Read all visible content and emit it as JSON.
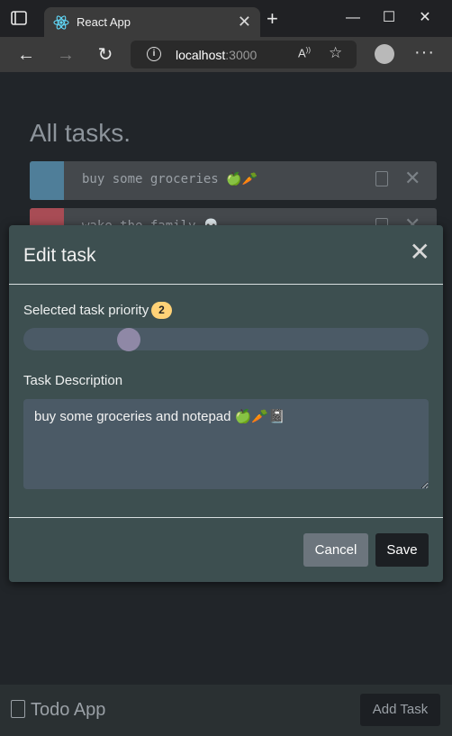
{
  "browser": {
    "tab_title": "React App",
    "close_tab": "✕",
    "new_tab": "+",
    "window_controls": {
      "minimize": "—",
      "maximize": "☐",
      "close": "✕"
    },
    "url_host": "localhost",
    "url_port": ":3000",
    "icons": [
      "tab-actions-icon",
      "react-logo-icon",
      "back-icon",
      "forward-icon",
      "refresh-icon",
      "info-icon",
      "read-aloud-icon",
      "favorites-icon",
      "profile-icon",
      "more-icon"
    ]
  },
  "app": {
    "heading": "All tasks.",
    "tasks": [
      {
        "description": "buy some groceries 🍏🥕",
        "priority_color": "#4f7e99"
      },
      {
        "description": "wake the family 💀",
        "priority_color": "#a84c55"
      }
    ]
  },
  "modal": {
    "title": "Edit task",
    "priority_label": "Selected task priority",
    "priority_value": "2",
    "priority_fraction": 0.26,
    "description_label": "Task Description",
    "description_value": "buy some groceries and notepad 🍏🥕📓",
    "cancel_label": "Cancel",
    "save_label": "Save",
    "close_glyph": "✕"
  },
  "footer": {
    "brand": "Todo App",
    "add_task_label": "Add Task"
  },
  "colors": {
    "badge": "#ffd277",
    "modal_bg": "#3d4f50",
    "slider_thumb": "#8f88a6"
  }
}
